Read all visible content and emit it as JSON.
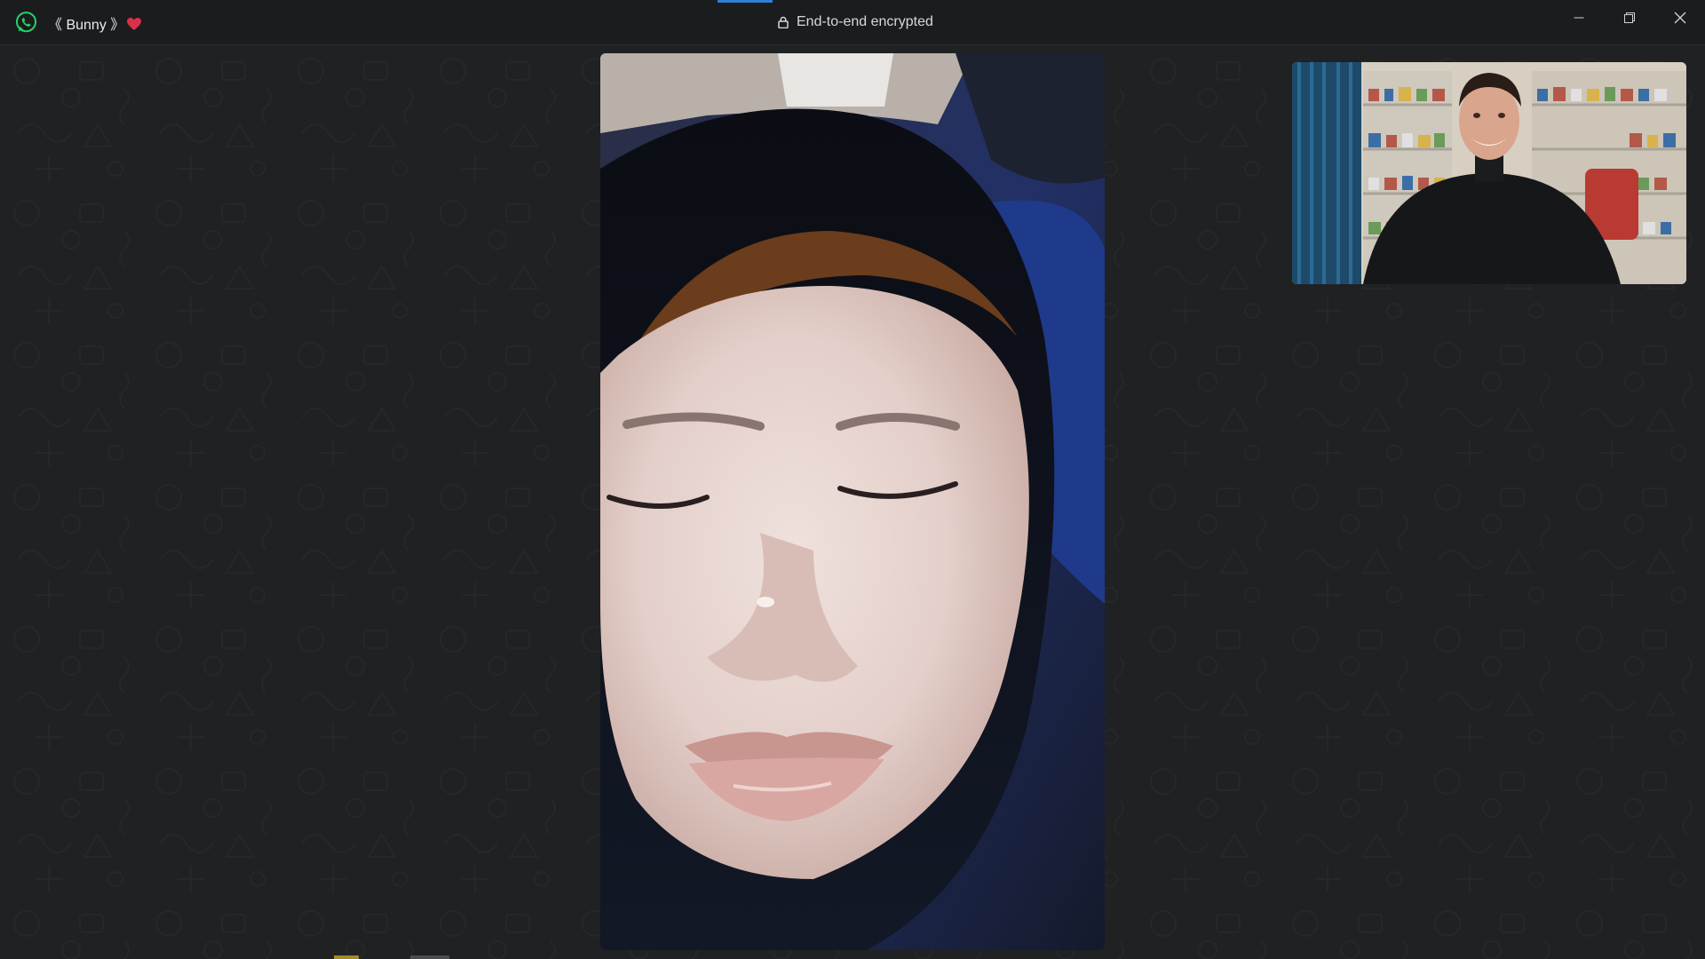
{
  "window": {
    "contact_name": "《 Bunny 》",
    "encryption_label": "End-to-end encrypted"
  },
  "icons": {
    "app_logo": "whatsapp-icon",
    "contact_badge": "heart-icon",
    "encryption": "lock-icon",
    "minimize": "minimize-icon",
    "restore": "restore-icon",
    "close": "close-icon"
  },
  "colors": {
    "background": "#202122",
    "titlebar": "#1b1c1d",
    "accent_tab": "#2f7fd6",
    "whatsapp_green": "#25d366",
    "heart": "#d9304b"
  }
}
